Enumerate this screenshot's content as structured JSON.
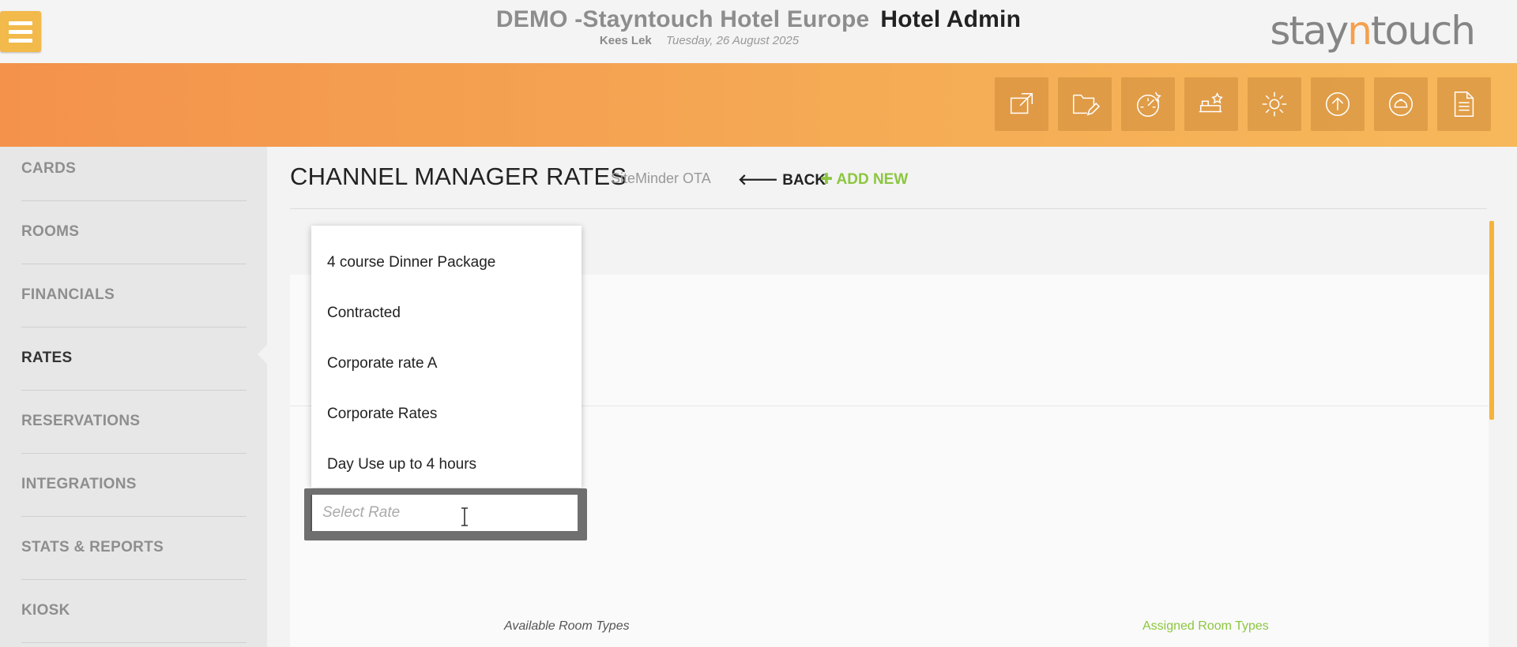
{
  "header": {
    "hotel_name": "DEMO -Stayntouch Hotel Europe",
    "app_title": "Hotel Admin",
    "user": "Kees Lek",
    "date": "Tuesday, 26 August 2025",
    "logo_text_pre": "stay",
    "logo_text_accent": "n",
    "logo_text_post": "touch"
  },
  "toolbar": {
    "icons": [
      "external-link-icon",
      "folder-edit-icon",
      "dashboard-icon",
      "housekeeping-icon",
      "settings-icon",
      "upload-icon",
      "bell-icon",
      "document-icon"
    ]
  },
  "sidebar": {
    "items": [
      {
        "label": "CARDS",
        "active": false
      },
      {
        "label": "ROOMS",
        "active": false
      },
      {
        "label": "FINANCIALS",
        "active": false
      },
      {
        "label": "RATES",
        "active": true
      },
      {
        "label": "RESERVATIONS",
        "active": false
      },
      {
        "label": "INTEGRATIONS",
        "active": false
      },
      {
        "label": "STATS & REPORTS",
        "active": false
      },
      {
        "label": "KIOSK",
        "active": false
      }
    ]
  },
  "page": {
    "title": "CHANNEL MANAGER RATES",
    "subtitle": "SiteMinder OTA",
    "back_label": "BACK",
    "add_new_label": "ADD NEW"
  },
  "rate_select": {
    "placeholder": "Select Rate",
    "options": [
      "4 course Dinner Package",
      "Contracted",
      "Corporate rate A",
      "Corporate Rates",
      "Day Use up to 4 hours"
    ]
  },
  "room_types": {
    "available_label": "Available Room Types",
    "assigned_label": "Assigned Room Types"
  },
  "colors": {
    "accent_orange": "#f5a04d",
    "menu_yellow": "#f2b94b",
    "add_green": "#8cc63f"
  }
}
